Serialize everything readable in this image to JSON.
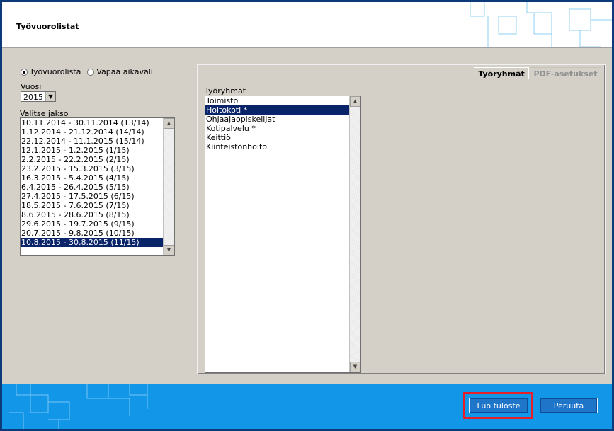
{
  "window": {
    "title": "Työvuorolistat"
  },
  "mode": {
    "options": [
      {
        "label": "Työvuorolista",
        "checked": true
      },
      {
        "label": "Vapaa aikaväli",
        "checked": false
      }
    ]
  },
  "year": {
    "label": "Vuosi",
    "value": "2015"
  },
  "period": {
    "label": "Valitse jakso",
    "items": [
      "10.11.2014 - 30.11.2014 (13/14)",
      "1.12.2014 - 21.12.2014 (14/14)",
      "22.12.2014 - 11.1.2015 (15/14)",
      "12.1.2015 - 1.2.2015 (1/15)",
      "2.2.2015 - 22.2.2015 (2/15)",
      "23.2.2015 - 15.3.2015 (3/15)",
      "16.3.2015 - 5.4.2015 (4/15)",
      "6.4.2015 - 26.4.2015 (5/15)",
      "27.4.2015 - 17.5.2015 (6/15)",
      "18.5.2015 - 7.6.2015 (7/15)",
      "8.6.2015 - 28.6.2015 (8/15)",
      "29.6.2015 - 19.7.2015 (9/15)",
      "20.7.2015 - 9.8.2015 (10/15)",
      "10.8.2015 - 30.8.2015 (11/15)"
    ],
    "selected": "10.8.2015 - 30.8.2015 (11/15)"
  },
  "tabs": {
    "active": "Työryhmät",
    "inactive": "PDF-asetukset"
  },
  "groups": {
    "label": "Työryhmät",
    "items": [
      "Toimisto",
      "Hoitokoti *",
      "Ohjaajaopiskelijat",
      "Kotipalvelu *",
      "Keittiö",
      "Kiinteistönhoito"
    ],
    "selected": "Hoitokoti *"
  },
  "footer": {
    "create_label": "Luo tuloste",
    "cancel_label": "Peruuta"
  },
  "colors": {
    "accent": "#1196e8",
    "selection": "#0a246a",
    "highlight": "#e51f2a",
    "button": "#1f76c9"
  },
  "icons": {
    "scroll_up": "scroll-up-icon",
    "scroll_down": "scroll-down-icon",
    "dropdown": "chevron-down-icon"
  }
}
